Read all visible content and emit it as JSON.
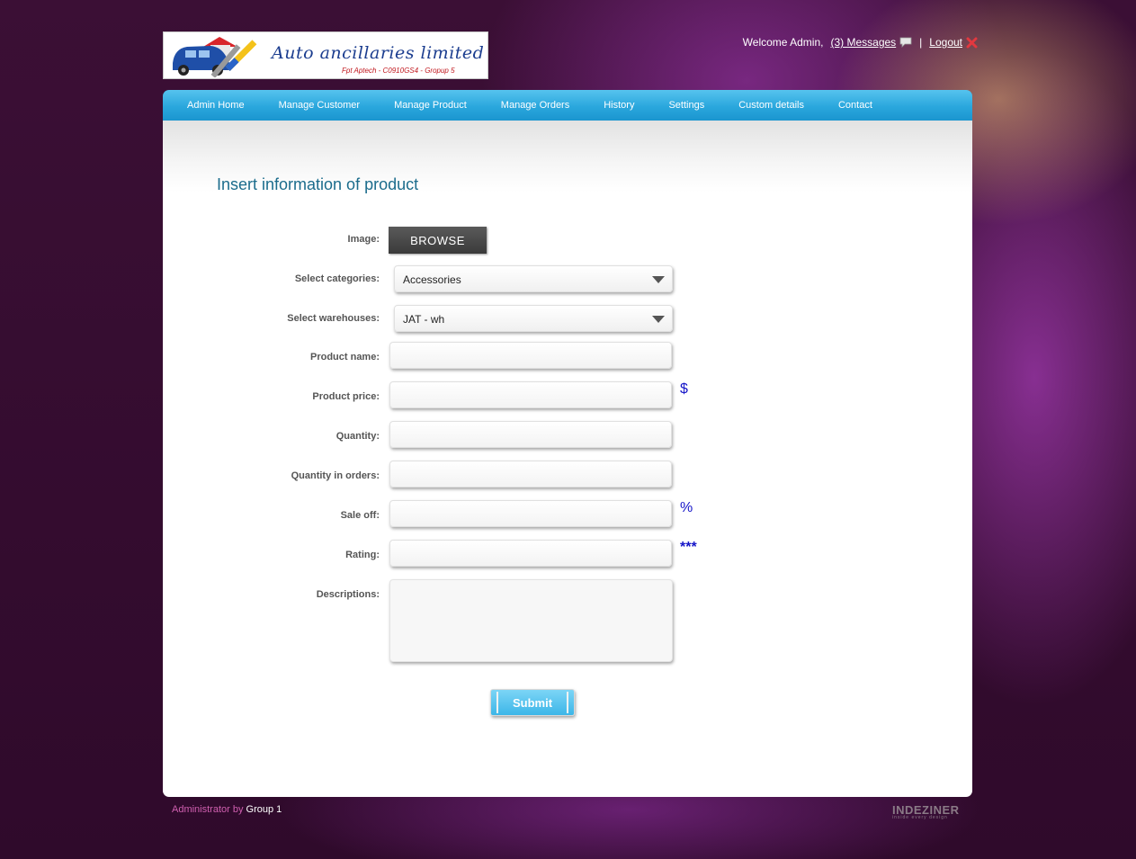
{
  "logo": {
    "brand": "Auto ancillaries limited",
    "tagline": "Fpt Aptech - C0910GS4 - Gropup 5"
  },
  "topbar": {
    "welcome": "Welcome Admin,",
    "messages": "(3) Messages",
    "separator": "|",
    "logout": "Logout"
  },
  "nav": {
    "items": [
      "Admin Home",
      "Manage Customer",
      "Manage Product",
      "Manage Orders",
      "History",
      "Settings",
      "Custom details",
      "Contact"
    ]
  },
  "form": {
    "title": "Insert information of product",
    "image_label": "Image:",
    "browse_label": "BROWSE",
    "categories_label": "Select categories:",
    "categories_value": "Accessories",
    "warehouses_label": "Select warehouses:",
    "warehouses_value": "JAT - wh",
    "product_name_label": "Product name:",
    "product_price_label": "Product price:",
    "price_suffix": "$",
    "quantity_label": "Quantity:",
    "quantity_in_orders_label": "Quantity in orders:",
    "sale_off_label": "Sale off:",
    "sale_suffix": "%",
    "rating_label": "Rating:",
    "rating_suffix": "***",
    "descriptions_label": "Descriptions:",
    "submit_label": "Submit"
  },
  "footer": {
    "admin_text": "Administrator by",
    "group_text": "Group 1",
    "designer": "INDEZINER",
    "designer_sub": "inside every design"
  },
  "colors": {
    "nav_blue": "#2aa7dd",
    "heading": "#1b6c8c",
    "background": "#3a0f32",
    "suffix_blue": "#1414c8"
  }
}
